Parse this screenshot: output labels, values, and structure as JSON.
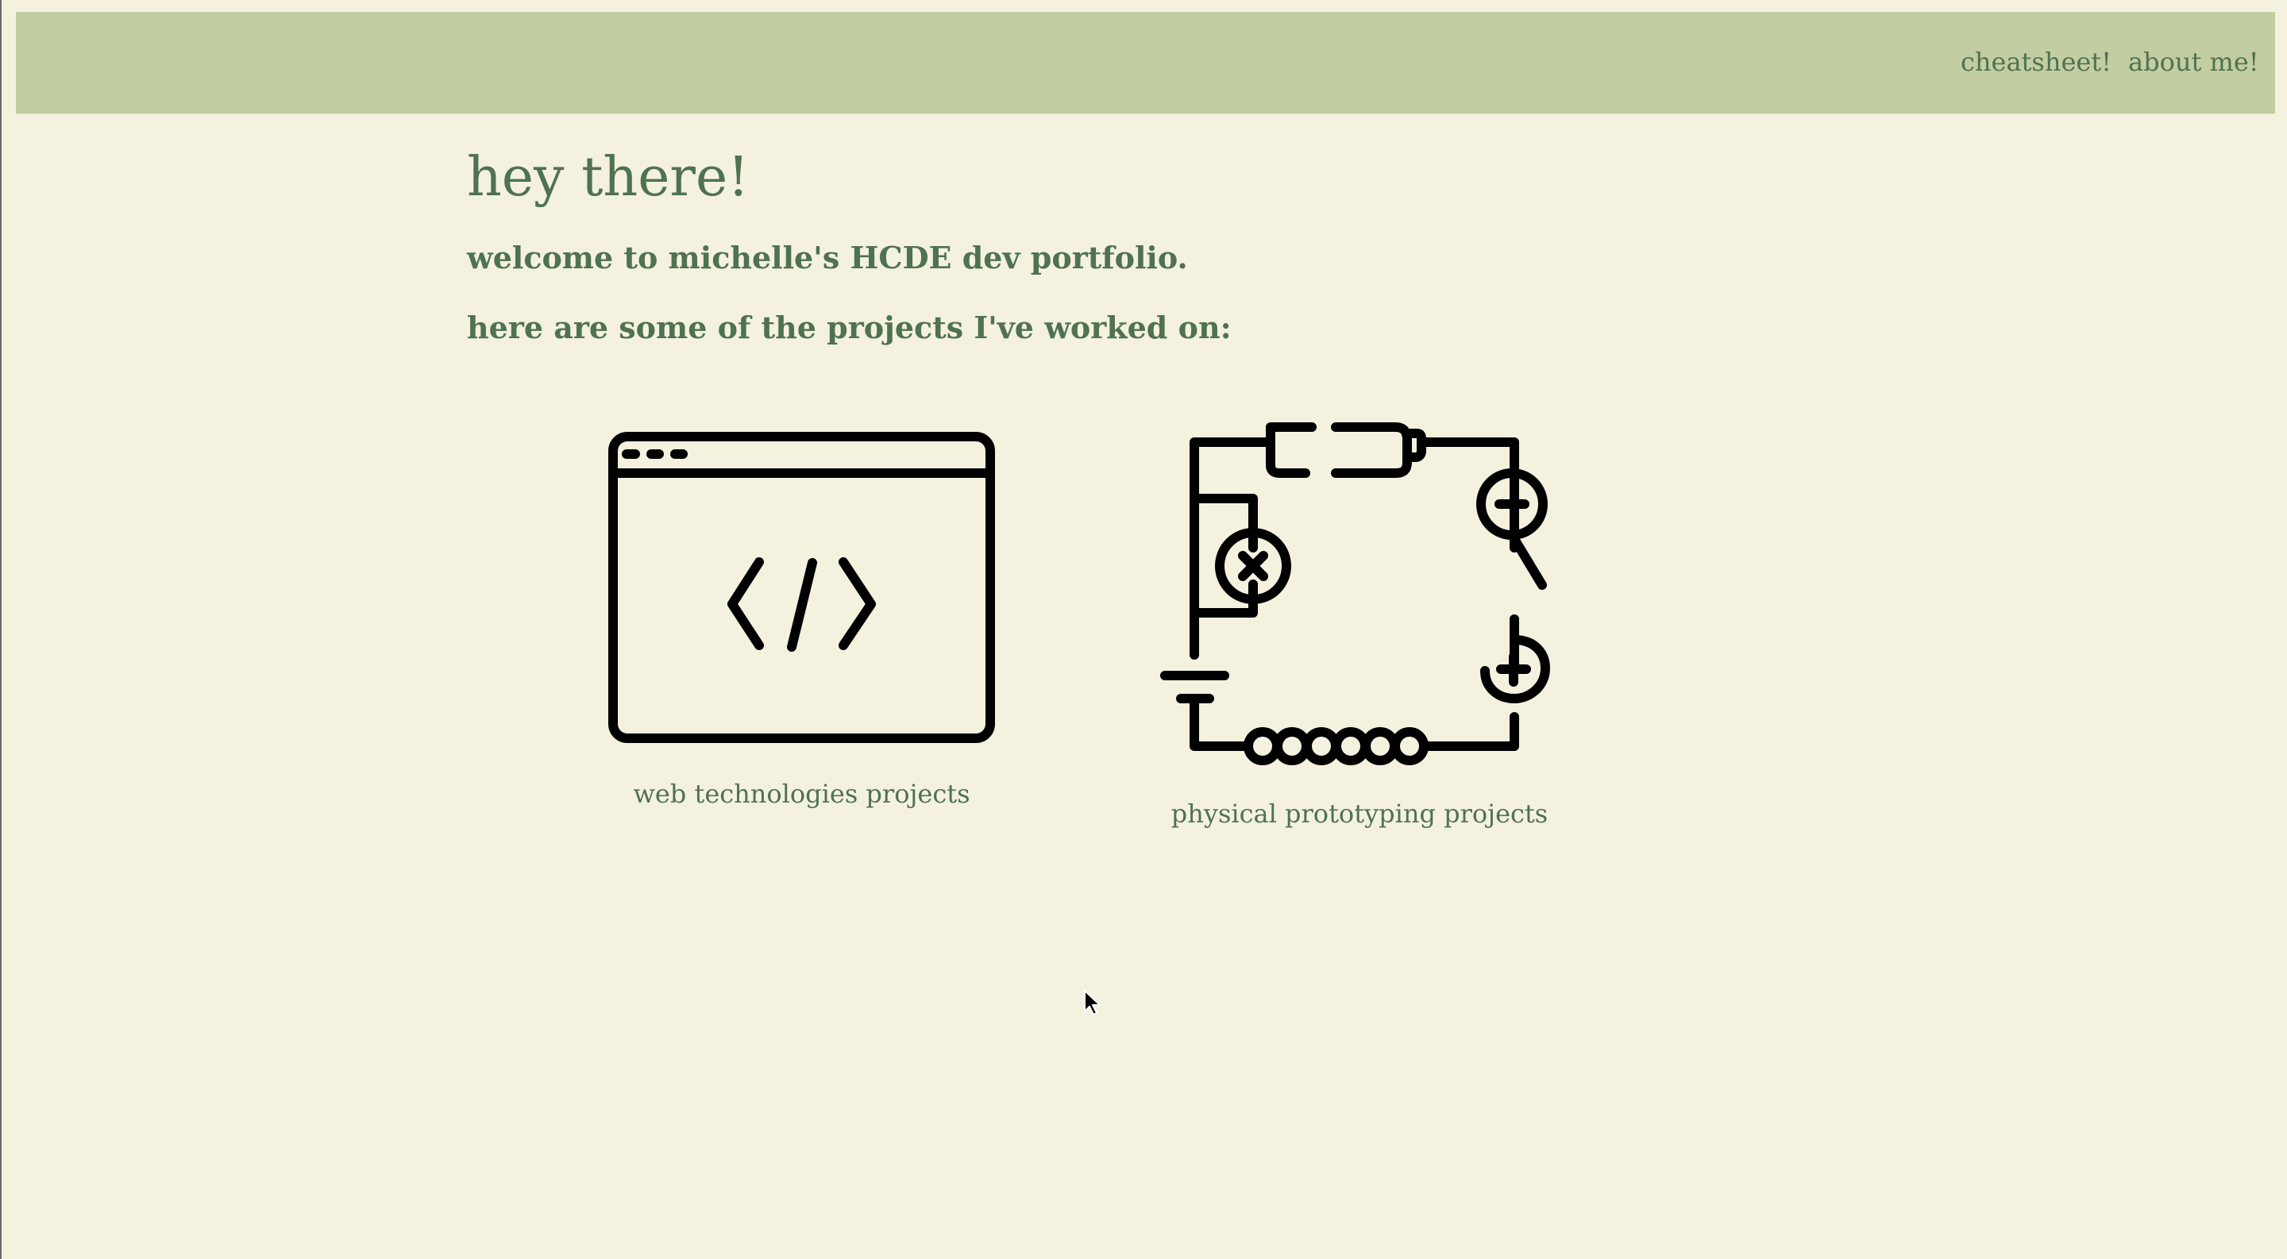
{
  "nav": {
    "cheatsheet": "cheatsheet!",
    "about": "about me!"
  },
  "hero": {
    "title": "hey there!",
    "welcome": "welcome to michelle's HCDE dev portfolio.",
    "intro": "here are some of the projects I've worked on:"
  },
  "projects": [
    {
      "label": "web technologies projects",
      "icon": "browser-code-icon"
    },
    {
      "label": "physical prototyping projects",
      "icon": "circuit-icon"
    }
  ],
  "colors": {
    "page_background": "#f4f1df",
    "nav_background": "#c3cda2",
    "text": "#4f7250",
    "icon": "#000000"
  }
}
